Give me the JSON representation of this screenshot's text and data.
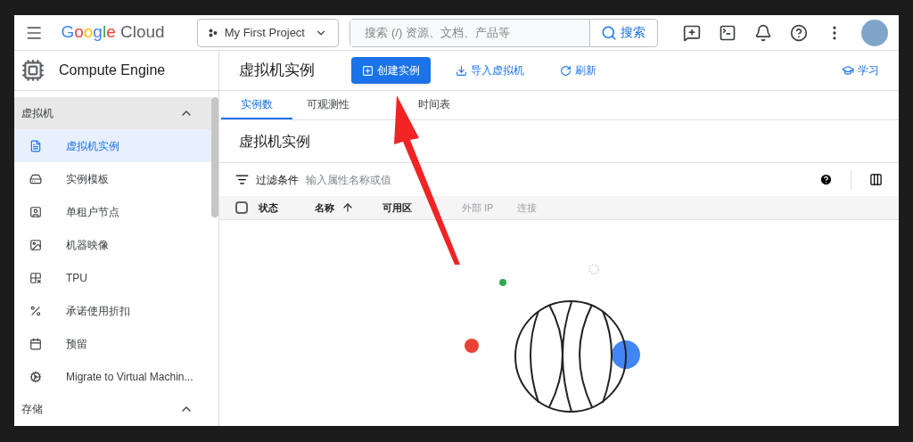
{
  "topbar": {
    "logo_brand": "Google",
    "logo_product": "Cloud",
    "project": "My First Project",
    "search": {
      "placeholder": "搜索 (/) 资源、文档、产品等"
    },
    "search_button": "搜索"
  },
  "sidebar": {
    "title": "Compute Engine",
    "sections": [
      {
        "label": "虚拟机",
        "expanded": true,
        "items": [
          {
            "label": "虚拟机实例",
            "selected": true
          },
          {
            "label": "实例模板",
            "selected": false
          },
          {
            "label": "单租户节点",
            "selected": false
          },
          {
            "label": "机器映像",
            "selected": false
          },
          {
            "label": "TPU",
            "selected": false
          },
          {
            "label": "承诺使用折扣",
            "selected": false
          },
          {
            "label": "预留",
            "selected": false
          },
          {
            "label": "Migrate to Virtual Machin...",
            "selected": false
          }
        ]
      },
      {
        "label": "存储",
        "expanded": true
      }
    ]
  },
  "header": {
    "title": "虚拟机实例",
    "actions": [
      {
        "kind": "primary",
        "label": "创建实例"
      },
      {
        "kind": "import",
        "label": "导入虚拟机"
      },
      {
        "kind": "refresh",
        "label": "刷新"
      }
    ],
    "learn": "学习"
  },
  "tabs": [
    {
      "label": "实例数",
      "selected": true
    },
    {
      "label": "可观测性",
      "selected": false
    },
    {
      "label": "时间表",
      "selected": false
    }
  ],
  "section_title": "虚拟机实例",
  "filter": {
    "label": "过滤条件",
    "placeholder": "输入属性名称或值"
  },
  "table": {
    "select_all_checked": false,
    "columns": [
      {
        "label": "状态",
        "muted": false
      },
      {
        "label": "名称",
        "muted": false,
        "sorted": true
      },
      {
        "label": "可用区",
        "muted": false
      },
      {
        "label": "外部 IP",
        "muted": true
      },
      {
        "label": "连接",
        "muted": true
      }
    ]
  }
}
